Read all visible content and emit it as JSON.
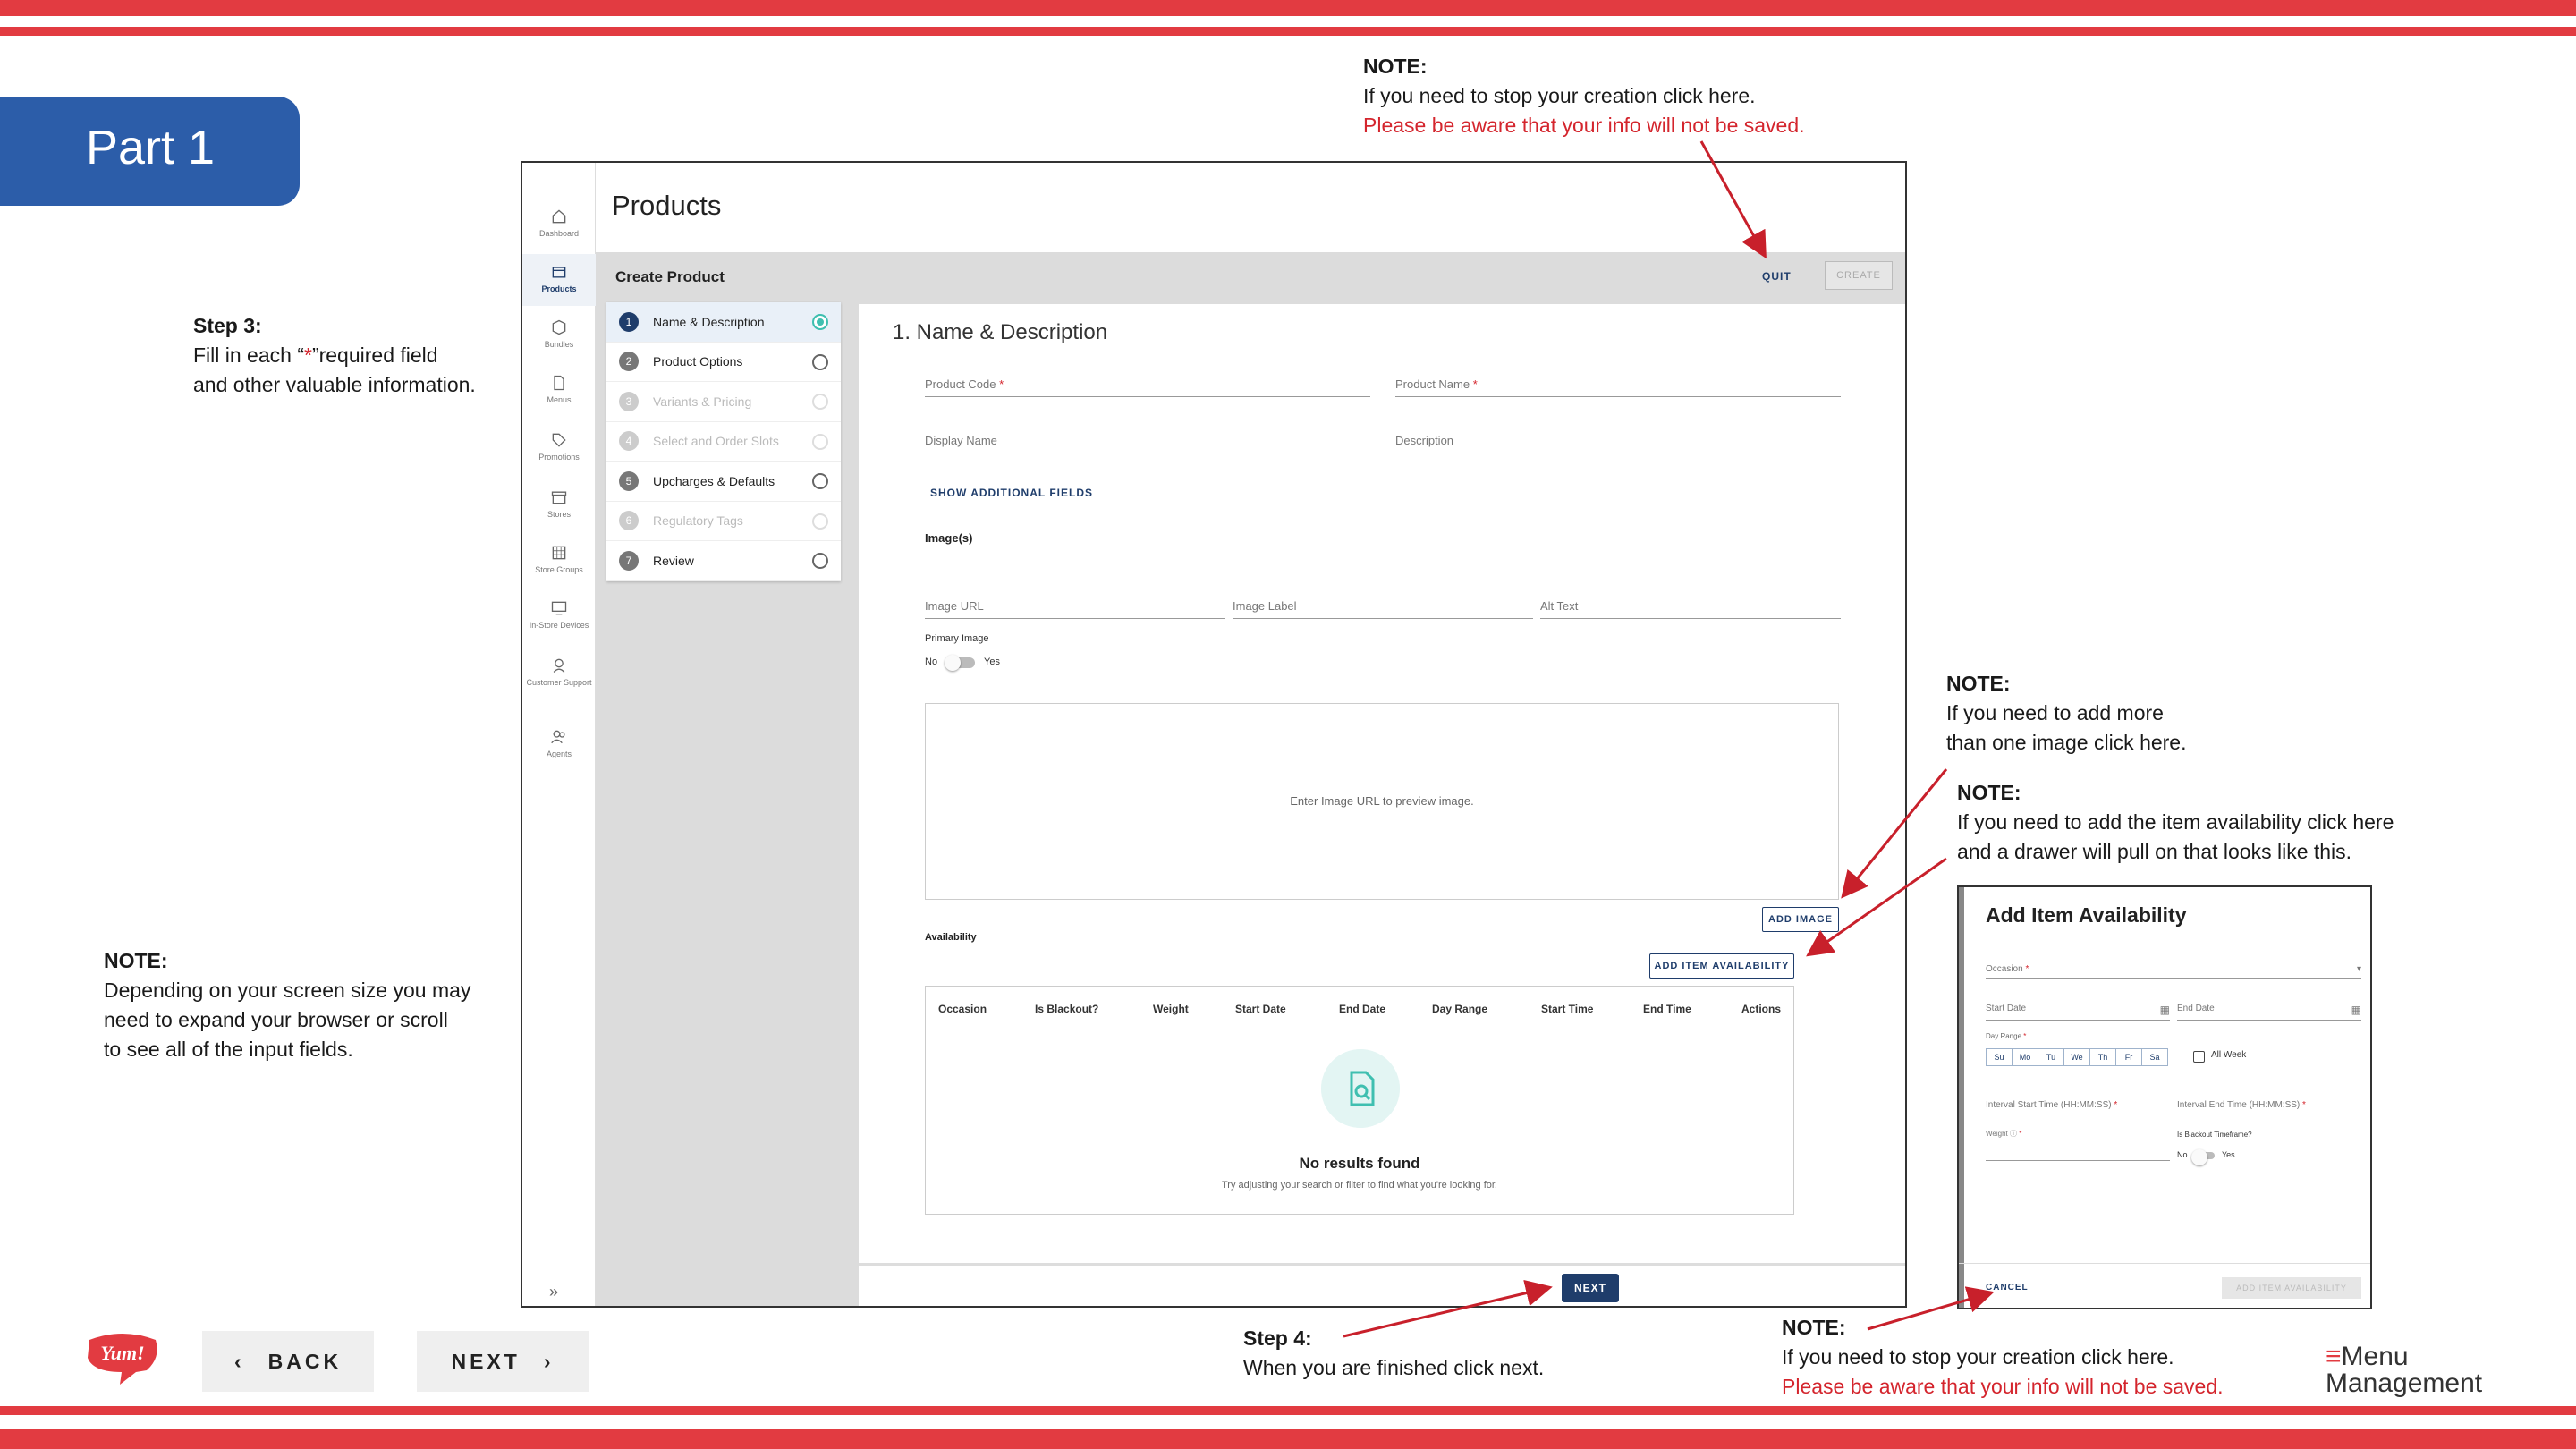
{
  "part_label": "Part 1",
  "notes": {
    "quit_note": {
      "head": "NOTE:",
      "line1": "If you need to stop your creation click here.",
      "line2": "Please be aware that your info will not be saved."
    },
    "step3": {
      "head": "Step 3:",
      "line1": "Fill in each “",
      "star": "*",
      "line1b": "”required field",
      "line2": "and other valuable information."
    },
    "screen_note": {
      "head": "NOTE:",
      "line1": "Depending on your screen size you may",
      "line2": "need to expand your browser or scroll",
      "line3": "to see all of the input fields."
    },
    "image_note": {
      "head": "NOTE:",
      "line1": "If you need to add more",
      "line2": "than one image click here."
    },
    "avail_note": {
      "head": "NOTE:",
      "line1": "If you need to add the item availability click here",
      "line2": "and a drawer will pull on that looks like this."
    },
    "step4": {
      "head": "Step 4:",
      "line1": "When you are finished click next."
    },
    "cancel_note": {
      "head": "NOTE:",
      "line1": "If you need to stop your creation click here.",
      "line2": "Please be aware that your info will not be saved."
    }
  },
  "nav": {
    "back": "BACK",
    "next": "NEXT"
  },
  "logos": {
    "yum": "Yum!",
    "mm_line1": "Menu",
    "mm_line2": "Management"
  },
  "app": {
    "title": "Products",
    "bar_title": "Create Product",
    "quit": "QUIT",
    "create": "CREATE",
    "sidebar": [
      {
        "label": "Dashboard",
        "icon": "home-icon"
      },
      {
        "label": "Products",
        "icon": "box-icon"
      },
      {
        "label": "Bundles",
        "icon": "cube-icon"
      },
      {
        "label": "Menus",
        "icon": "document-icon"
      },
      {
        "label": "Promotions",
        "icon": "tag-icon"
      },
      {
        "label": "Stores",
        "icon": "store-icon"
      },
      {
        "label": "Store Groups",
        "icon": "grid-icon"
      },
      {
        "label": "In-Store Devices",
        "icon": "monitor-icon"
      },
      {
        "label": "Customer Support",
        "icon": "support-icon"
      },
      {
        "label": "Agents",
        "icon": "people-icon"
      }
    ],
    "steps": [
      {
        "num": "1",
        "label": "Name & Description"
      },
      {
        "num": "2",
        "label": "Product Options"
      },
      {
        "num": "3",
        "label": "Variants & Pricing"
      },
      {
        "num": "4",
        "label": "Select and Order Slots"
      },
      {
        "num": "5",
        "label": "Upcharges & Defaults"
      },
      {
        "num": "6",
        "label": "Regulatory Tags"
      },
      {
        "num": "7",
        "label": "Review"
      }
    ],
    "section_title": "1. Name & Description",
    "fields": {
      "product_code": "Product Code",
      "product_name": "Product Name",
      "display_name": "Display Name",
      "description": "Description",
      "image_url": "Image URL",
      "image_label": "Image Label",
      "alt_text": "Alt Text",
      "req_star": "*"
    },
    "show_additional": "SHOW ADDITIONAL FIELDS",
    "images_label": "Image(s)",
    "primary_image": "Primary Image",
    "no": "No",
    "yes": "Yes",
    "preview_text": "Enter Image URL to preview image.",
    "add_image": "ADD IMAGE",
    "availability": "Availability",
    "add_item_availability": "ADD ITEM AVAILABILITY",
    "table_headers": [
      "Occasion",
      "Is Blackout?",
      "Weight",
      "Start Date",
      "End Date",
      "Day Range",
      "Start Time",
      "End Time",
      "Actions"
    ],
    "empty_title": "No results found",
    "empty_sub": "Try adjusting your search or filter to find what you're looking for.",
    "next": "NEXT",
    "collapse": "»"
  },
  "drawer": {
    "title": "Add Item Availability",
    "occasion": "Occasion",
    "start_date": "Start Date",
    "end_date": "End Date",
    "day_range": "Day Range",
    "days": [
      "Su",
      "Mo",
      "Tu",
      "We",
      "Th",
      "Fr",
      "Sa"
    ],
    "all_week": "All Week",
    "interval_start": "Interval Start Time (HH:MM:SS)",
    "interval_end": "Interval End Time (HH:MM:SS)",
    "weight": "Weight",
    "blackout": "Is Blackout Timeframe?",
    "no": "No",
    "yes": "Yes",
    "cancel": "CANCEL",
    "add": "ADD ITEM AVAILABILITY",
    "req_star": "*"
  },
  "colors": {
    "brand_red": "#e23b41",
    "part_blue": "#2c5da9",
    "navy": "#1f3d6b",
    "teal": "#3fbfb0",
    "note_red": "#d4252d"
  }
}
